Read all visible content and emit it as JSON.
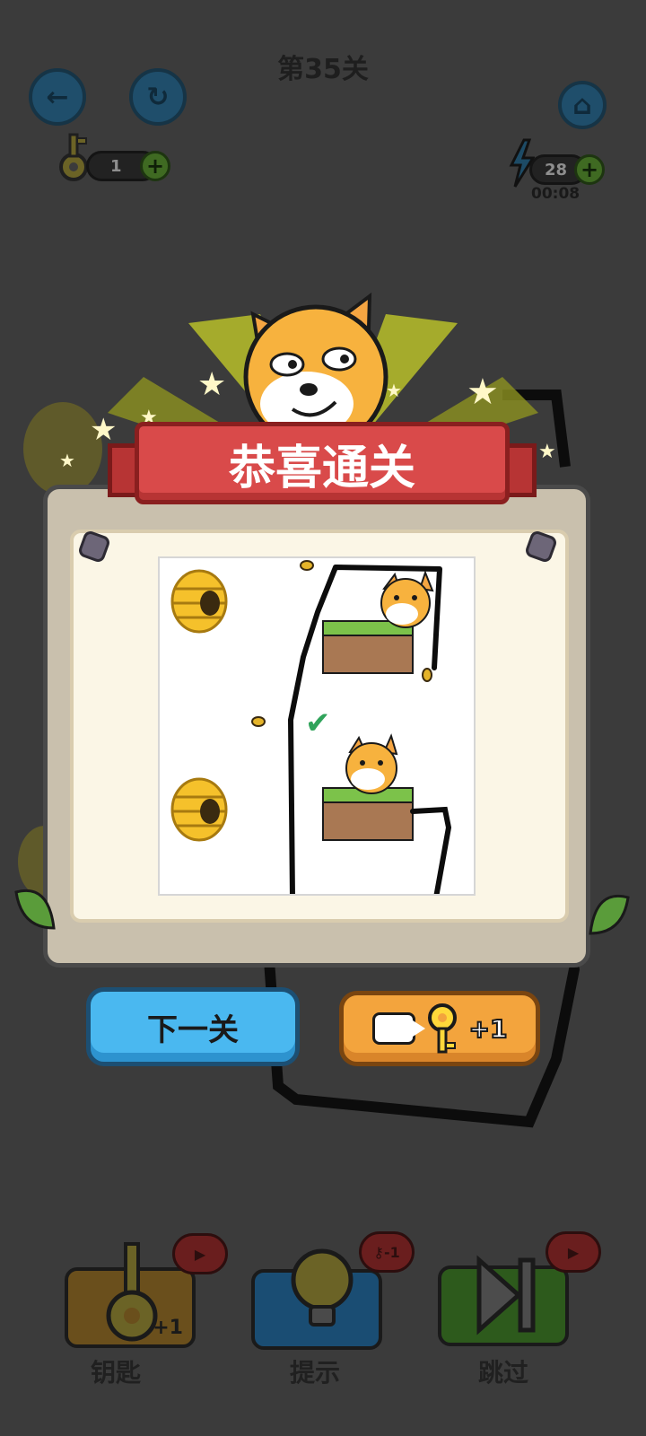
{
  "header": {
    "level_title": "第35关",
    "back_icon": "arrow-left-icon",
    "restart_icon": "restart-icon",
    "home_icon": "home-icon"
  },
  "keys": {
    "count": "1",
    "plus": "+"
  },
  "energy": {
    "count": "28",
    "plus": "+",
    "timer": "00:08"
  },
  "overlay": {
    "banner_title": "恭喜通关",
    "next_button": "下一关",
    "reward_button": "+1"
  },
  "tools": [
    {
      "label": "钥匙",
      "badge": "",
      "extra": "+1"
    },
    {
      "label": "提示",
      "badge": "-1",
      "extra": ""
    },
    {
      "label": "跳过",
      "badge": "",
      "extra": ""
    }
  ],
  "colors": {
    "background": "#3b3b3b",
    "banner": "#d94a4a",
    "next_button": "#4ab8f0",
    "reward_button": "#f3a43d",
    "check": "#2fa35a"
  }
}
